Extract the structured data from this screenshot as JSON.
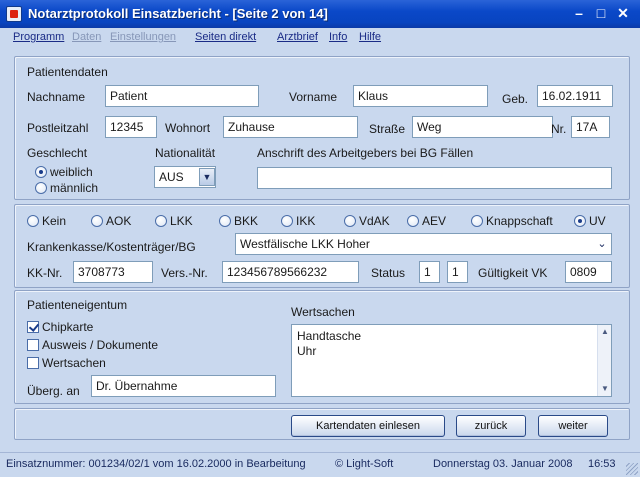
{
  "window": {
    "title": "Notarztprotokoll Einsatzbericht - [Seite 2 von 14]",
    "minimize": "–",
    "maximize": "□",
    "close": "✕"
  },
  "menu": [
    {
      "label": "Programm",
      "enabled": true
    },
    {
      "label": "Daten",
      "enabled": false
    },
    {
      "label": "Einstellungen",
      "enabled": false
    },
    {
      "label": "Seiten direkt",
      "enabled": true
    },
    {
      "label": "Arztbrief",
      "enabled": true
    },
    {
      "label": "Info",
      "enabled": true
    },
    {
      "label": "Hilfe",
      "enabled": true
    }
  ],
  "patient": {
    "section_title": "Patientendaten",
    "nachname_label": "Nachname",
    "nachname": "Patient",
    "vorname_label": "Vorname",
    "vorname": "Klaus",
    "geb_label": "Geb.",
    "geb": "16.02.1911",
    "plz_label": "Postleitzahl",
    "plz": "12345",
    "wohnort_label": "Wohnort",
    "wohnort": "Zuhause",
    "strasse_label": "Straße",
    "strasse": "Weg",
    "nr_label": "Nr.",
    "nr": "17A",
    "geschlecht_label": "Geschlecht",
    "weiblich": "weiblich",
    "maennlich": "männlich",
    "nationalitaet_label": "Nationalität",
    "nationalitaet": "AUS",
    "arbeitgeber_label": "Anschrift des Arbeitgebers bei BG Fällen",
    "arbeitgeber": ""
  },
  "insurance": {
    "options": [
      "Kein",
      "AOK",
      "LKK",
      "BKK",
      "IKK",
      "VdAK",
      "AEV",
      "Knappschaft",
      "UV"
    ],
    "selected": "UV",
    "kasse_label": "Krankenkasse/Kostenträger/BG",
    "kasse": "Westfälische LKK Hoher",
    "kknr_label": "KK-Nr.",
    "kknr": "3708773",
    "versnr_label": "Vers.-Nr.",
    "versnr": "123456789566232",
    "status_label": "Status",
    "status1": "1",
    "status2": "1",
    "gueltig_label": "Gültigkeit VK",
    "gueltig": "0809"
  },
  "property": {
    "section_title": "Patienteneigentum",
    "items": [
      {
        "label": "Chipkarte",
        "checked": true
      },
      {
        "label": "Ausweis / Dokumente",
        "checked": false
      },
      {
        "label": "Wertsachen",
        "checked": false
      }
    ],
    "uebergeben_label": "Überg. an",
    "uebergeben": "Dr. Übernahme",
    "wertsachen_label": "Wertsachen",
    "wertsachen_lines": [
      "Handtasche",
      "Uhr"
    ]
  },
  "buttons": {
    "karte": "Kartendaten einlesen",
    "zurueck": "zurück",
    "weiter": "weiter"
  },
  "status": {
    "einsatz": "Einsatznummer: 001234/02/1 vom 16.02.2000 in Bearbeitung",
    "copyright": "© Light-Soft",
    "date": "Donnerstag  03.  Januar  2008",
    "time": "16:53"
  }
}
